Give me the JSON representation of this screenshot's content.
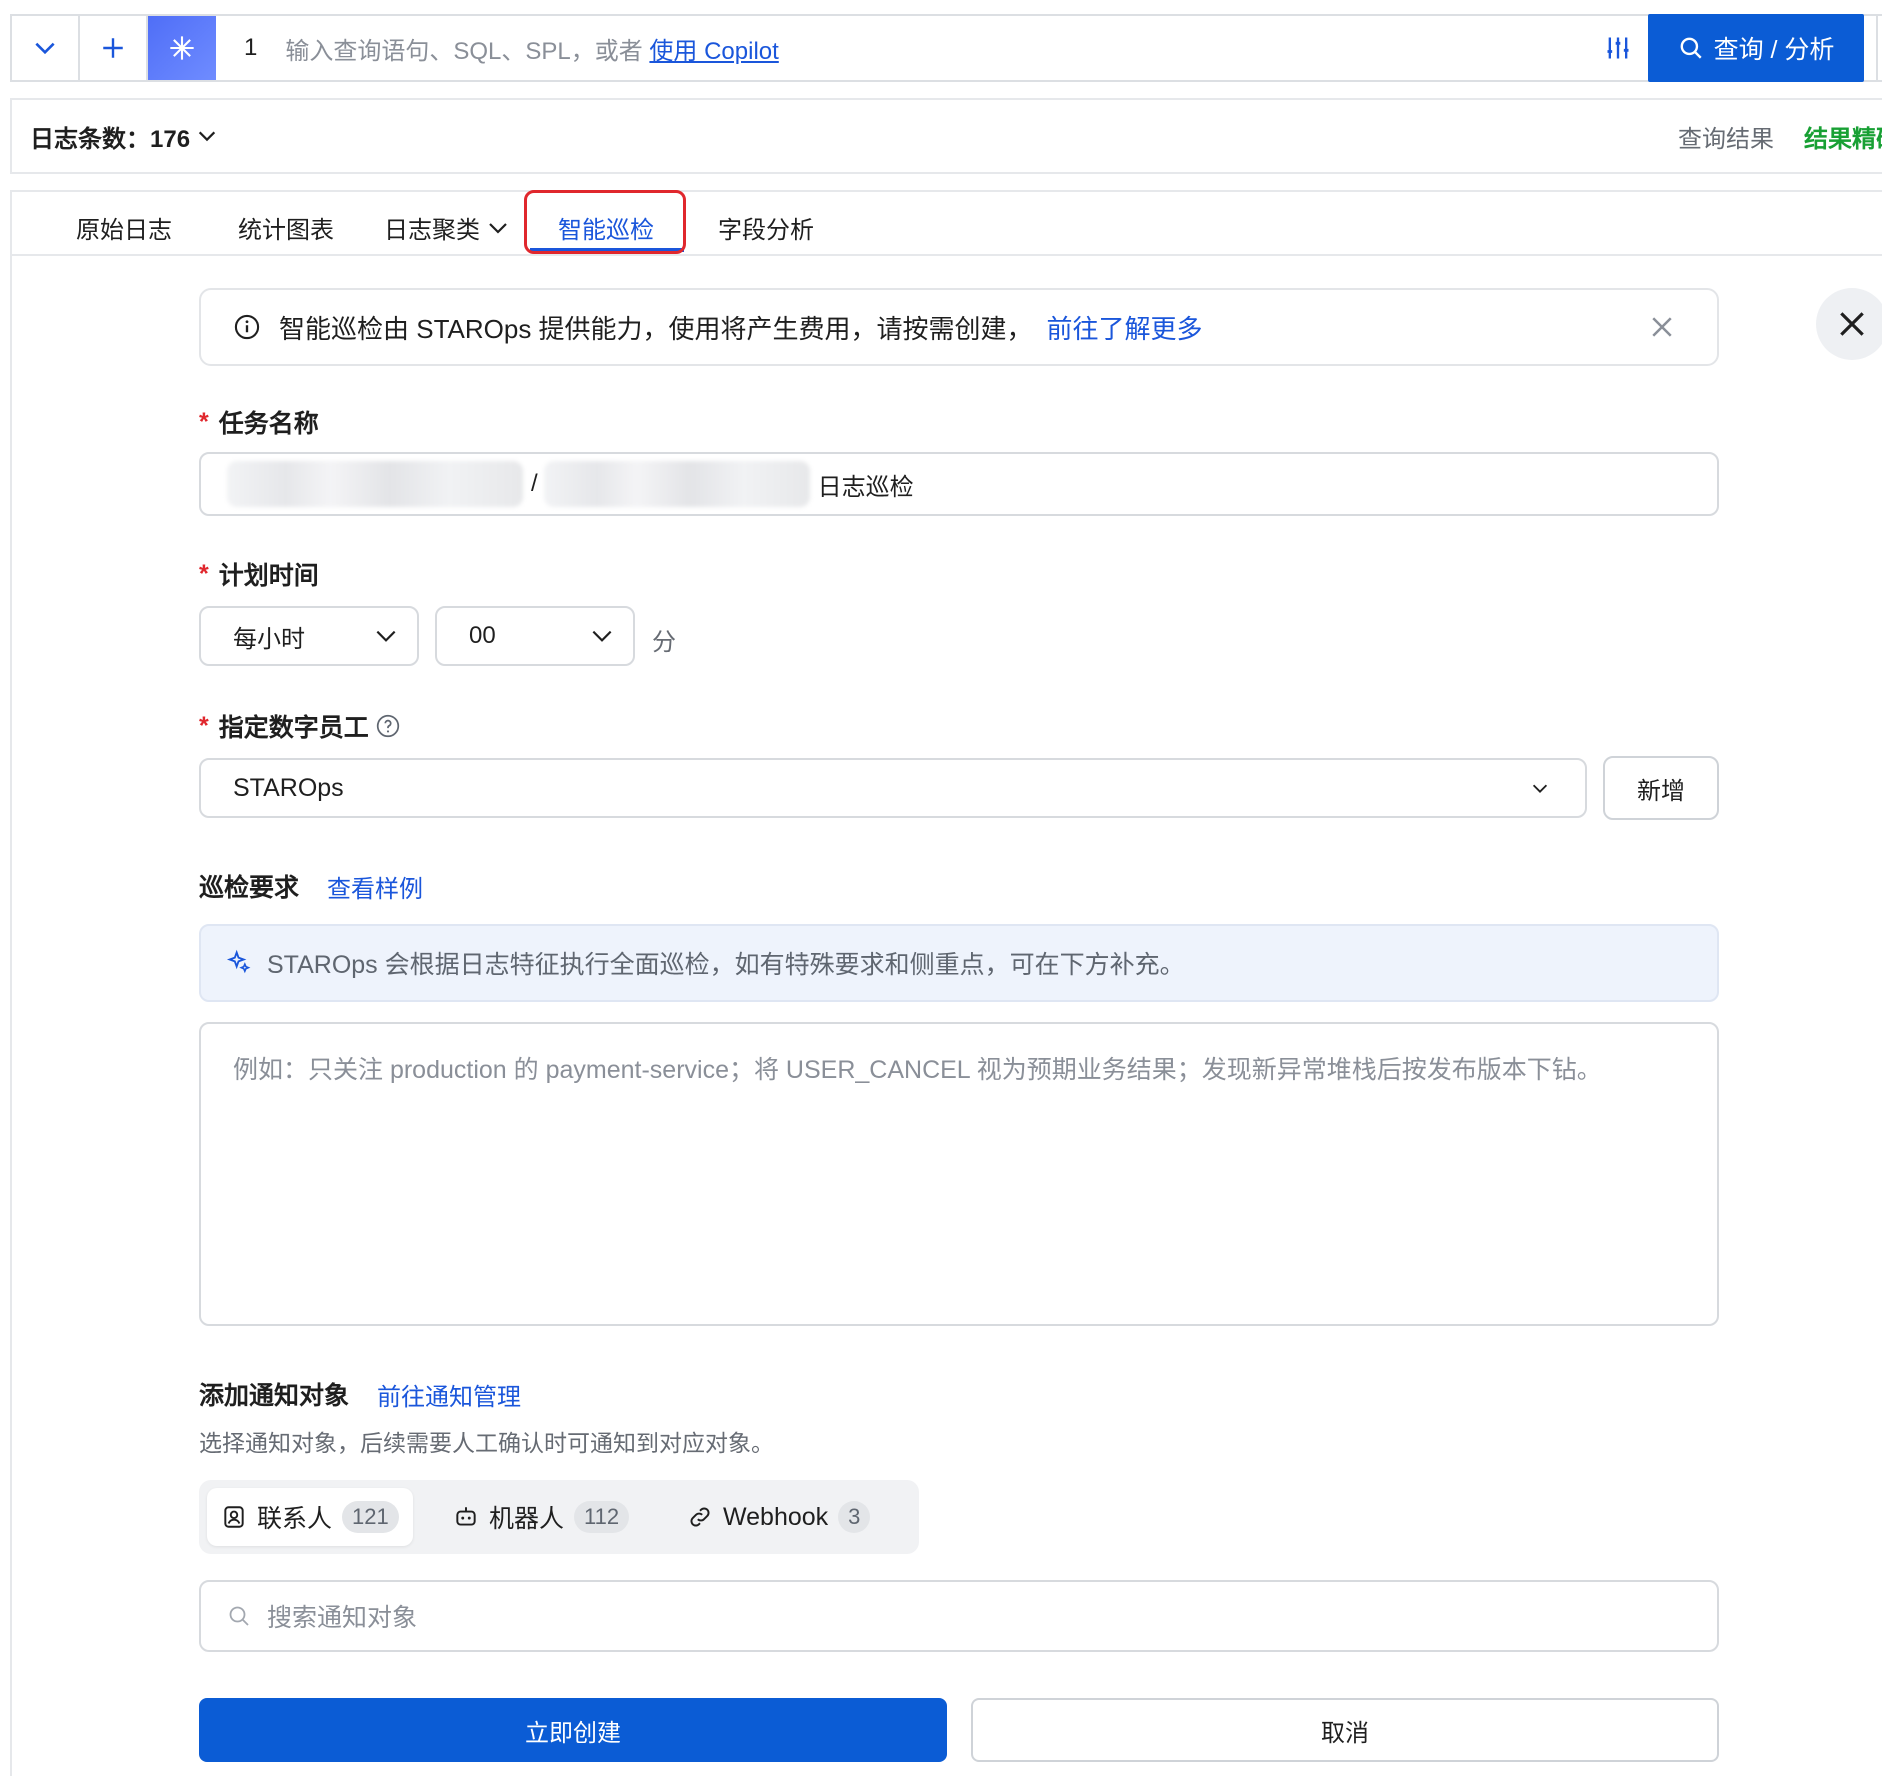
{
  "query_bar": {
    "line_number": "1",
    "placeholder_text": "输入查询语句、SQL、SPL，或者",
    "copilot_link": "使用 Copilot",
    "search_button": "查询 / 分析"
  },
  "count_bar": {
    "label": "日志条数：176",
    "query_result": "查询结果",
    "result_precise": "结果精确"
  },
  "tabs": [
    {
      "label": "原始日志"
    },
    {
      "label": "统计图表"
    },
    {
      "label": "日志聚类"
    },
    {
      "label": "智能巡检"
    },
    {
      "label": "字段分析"
    }
  ],
  "notice": {
    "text": "智能巡检由 STAROps 提供能力，使用将产生费用，请按需创建，",
    "link": "前往了解更多"
  },
  "form": {
    "task_name": {
      "label": "任务名称",
      "separator": "/",
      "suffix": "日志巡检"
    },
    "schedule": {
      "label": "计划时间",
      "frequency": "每小时",
      "minute": "00",
      "unit": "分"
    },
    "worker": {
      "label": "指定数字员工",
      "value": "STAROps",
      "add_button": "新增"
    },
    "requirements": {
      "label": "巡检要求",
      "example_link": "查看样例",
      "hint": "STAROps 会根据日志特征执行全面巡检，如有特殊要求和侧重点，可在下方补充。",
      "placeholder": "例如：只关注 production 的 payment-service；将 USER_CANCEL 视为预期业务结果；发现新异常堆栈后按发布版本下钻。"
    },
    "notify": {
      "label": "添加通知对象",
      "manage_link": "前往通知管理",
      "description": "选择通知对象，后续需要人工确认时可通知到对应对象。",
      "segments": [
        {
          "label": "联系人",
          "count": "121"
        },
        {
          "label": "机器人",
          "count": "112"
        },
        {
          "label": "Webhook",
          "count": "3"
        }
      ],
      "search_placeholder": "搜索通知对象"
    },
    "submit": "立即创建",
    "cancel": "取消"
  },
  "colors": {
    "primary": "#0b5cd5",
    "link": "#1a56db",
    "required": "#e0272d",
    "success": "#18a034",
    "highlight_border": "#e0272d"
  }
}
